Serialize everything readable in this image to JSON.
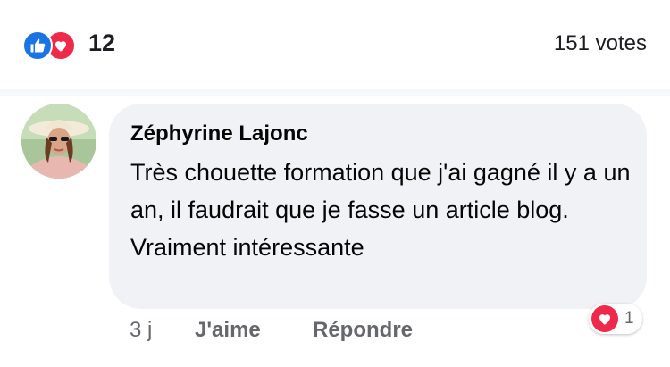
{
  "post_reactions": {
    "count": "12",
    "votes": "151 votes",
    "icons": [
      "like-icon",
      "love-icon"
    ]
  },
  "comment": {
    "author": "Zéphyrine Lajonc",
    "text": "Très chouette formation que j'ai gagné il y a un an, il faudrait que je fasse un article blog. Vraiment intéressante",
    "time": "3 j",
    "like_label": "J'aime",
    "reply_label": "Répondre",
    "reaction_count": "1",
    "reaction_icon": "love-icon"
  },
  "colors": {
    "like": "#1b74e4",
    "love": "#f0284a",
    "bubble": "#f0f2f5",
    "secondary_text": "#65676b"
  }
}
